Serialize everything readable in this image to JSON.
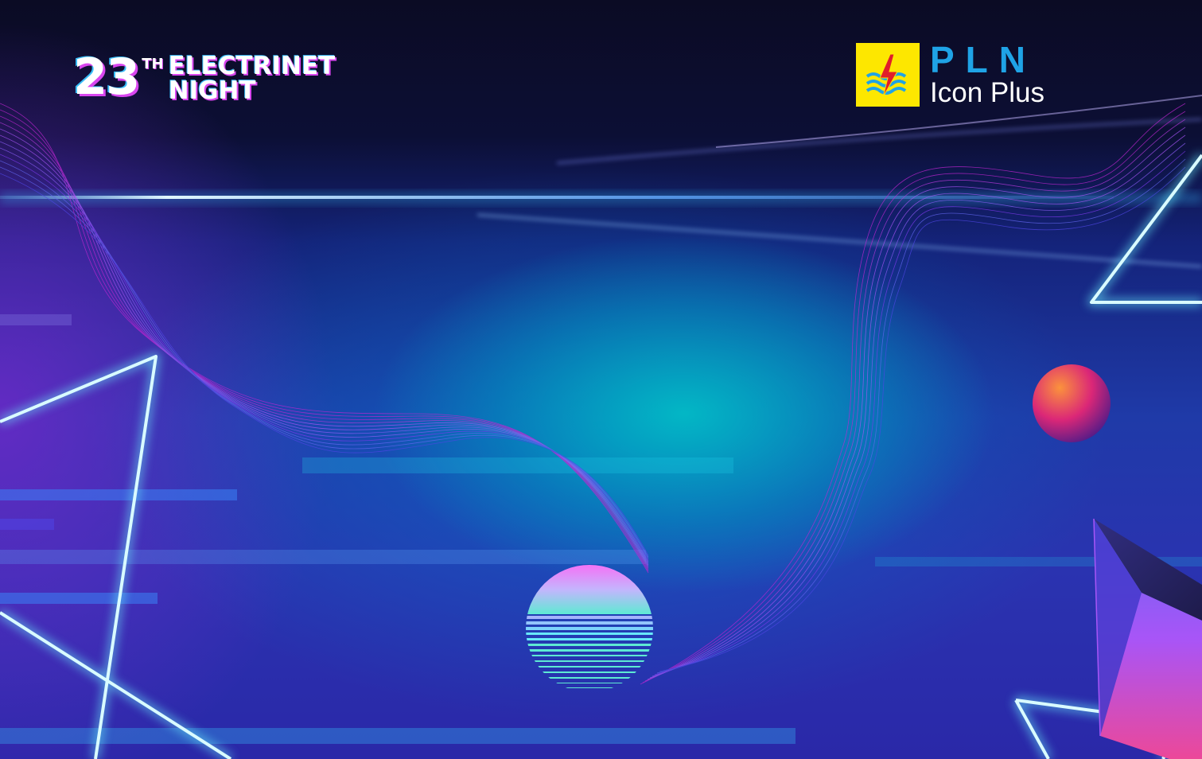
{
  "event": {
    "number": "23",
    "suffix": "TH",
    "name_line1": "ELECTRINET",
    "name_line2": "NIGHT"
  },
  "brand": {
    "name": "PLN",
    "subtitle": "Icon Plus",
    "logo_icon": "lightning-waves-icon",
    "colors": {
      "logo_background": "#fde700",
      "name": "#1fa3e6",
      "subtitle": "#ffffff"
    }
  },
  "colors": {
    "top": "#0b0b24",
    "cyan_glow": "#00c8c8",
    "violet": "#6e28c8",
    "neon_outline": "#bff6ff",
    "wave_magenta": "#d946ef"
  }
}
